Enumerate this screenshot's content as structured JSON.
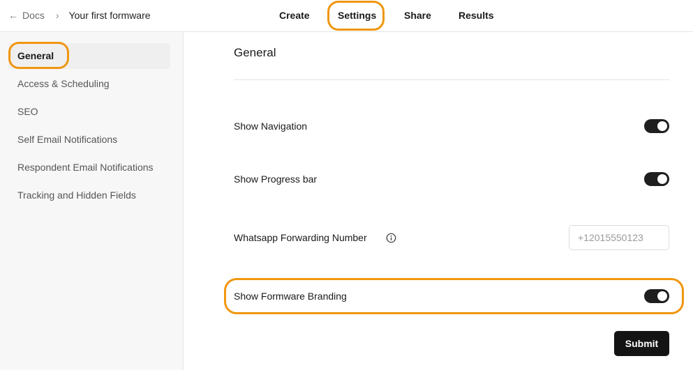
{
  "header": {
    "back_label": "Docs",
    "breadcrumb_separator": "›",
    "form_title": "Your first formware",
    "tabs": [
      {
        "label": "Create"
      },
      {
        "label": "Settings"
      },
      {
        "label": "Share"
      },
      {
        "label": "Results"
      }
    ],
    "active_tab": "Settings"
  },
  "sidebar": {
    "items": [
      {
        "label": "General"
      },
      {
        "label": "Access & Scheduling"
      },
      {
        "label": "SEO"
      },
      {
        "label": "Self Email Notifications"
      },
      {
        "label": "Respondent Email Notifications"
      },
      {
        "label": "Tracking and Hidden Fields"
      }
    ],
    "active_item": "General"
  },
  "main": {
    "title": "General",
    "settings": {
      "show_navigation": {
        "label": "Show Navigation",
        "enabled": true
      },
      "show_progress_bar": {
        "label": "Show Progress bar",
        "enabled": true
      },
      "whatsapp_number": {
        "label": "Whatsapp Forwarding Number",
        "placeholder": "+12015550123",
        "value": ""
      },
      "show_branding": {
        "label": "Show Formware Branding",
        "enabled": true
      }
    },
    "submit_label": "Submit"
  },
  "colors": {
    "highlight": "#f0960f",
    "toggle_on": "#1f1f1f",
    "button_bg": "#141414",
    "sidebar_bg": "#f7f7f7"
  },
  "icons": {
    "back": "arrow-left-icon",
    "info": "info-icon"
  }
}
